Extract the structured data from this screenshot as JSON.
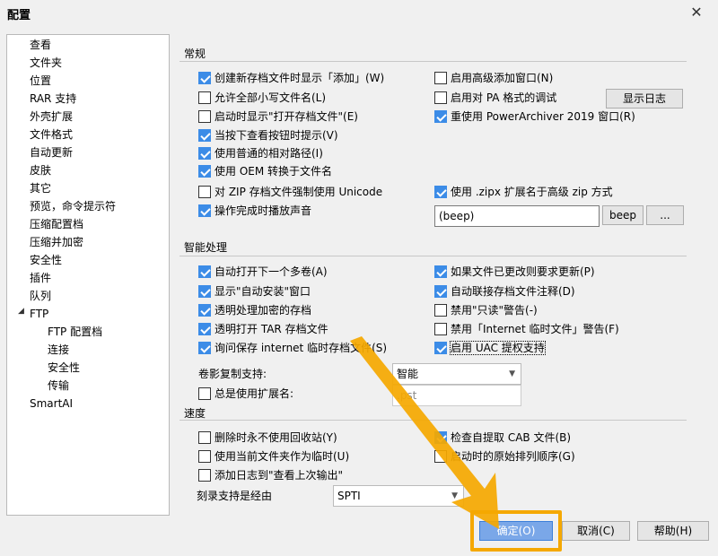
{
  "window": {
    "title": "配置",
    "close_glyph": "✕"
  },
  "tree": {
    "items": [
      "查看",
      "文件夹",
      "位置",
      "RAR 支持",
      "外壳扩展",
      "文件格式",
      "自动更新",
      "皮肤",
      "其它",
      "预览，命令提示符",
      "压缩配置档",
      "压缩并加密",
      "安全性",
      "插件",
      "队列",
      "FTP"
    ],
    "ftp_children": [
      "FTP 配置档",
      "连接",
      "安全性",
      "传输"
    ],
    "last": "SmartAI",
    "expand_glyph": "◢"
  },
  "general": {
    "title": "常规",
    "left": [
      {
        "label": "创建新存档文件时显示「添加」(W)",
        "checked": true
      },
      {
        "label": "允许全部小写文件名(L)",
        "checked": false
      },
      {
        "label": "启动时显示\"打开存档文件\"(E)",
        "checked": false
      },
      {
        "label": "当按下查看按钮时提示(V)",
        "checked": true
      },
      {
        "label": "使用普通的相对路径(I)",
        "checked": true
      },
      {
        "label": "使用 OEM 转换于文件名",
        "checked": true
      },
      {
        "label": "对 ZIP 存档文件强制使用 Unicode",
        "checked": false
      },
      {
        "label": "操作完成时播放声音",
        "checked": true
      }
    ],
    "right": [
      {
        "label": "启用高级添加窗口(N)",
        "checked": false
      },
      {
        "label": "启用对 PA 格式的调试",
        "checked": false
      },
      {
        "label": "重使用 PowerArchiver 2019 窗口(R)",
        "checked": true
      },
      {
        "label": "使用 .zipx 扩展名于高级 zip 方式",
        "checked": true
      }
    ],
    "show_log_button": "显示日志",
    "sound_value": "(beep)",
    "beep_button": "beep",
    "browse_button": "..."
  },
  "smart": {
    "title": "智能处理",
    "left": [
      {
        "label": "自动打开下一个多卷(A)",
        "checked": true
      },
      {
        "label": "显示\"自动安装\"窗口",
        "checked": true
      },
      {
        "label": "透明处理加密的存档",
        "checked": true
      },
      {
        "label": "透明打开 TAR 存档文件",
        "checked": true
      },
      {
        "label": "询问保存 internet 临时存档文件(S)",
        "checked": true
      }
    ],
    "right": [
      {
        "label": "如果文件已更改则要求更新(P)",
        "checked": true
      },
      {
        "label": "自动联接存档文件注释(D)",
        "checked": true
      },
      {
        "label": "禁用\"只读\"警告(-)",
        "checked": false
      },
      {
        "label": "禁用「Internet 临时文件」警告(F)",
        "checked": false
      },
      {
        "label": "启用 UAC 提权支持",
        "checked": true
      }
    ],
    "shadow_label": "卷影复制支持:",
    "shadow_value": "智能",
    "always_ext_label": "总是使用扩展名:",
    "always_ext_checked": false,
    "ext_value": ".pst"
  },
  "speed": {
    "title": "速度",
    "left": [
      {
        "label": "删除时永不使用回收站(Y)",
        "checked": false
      },
      {
        "label": "使用当前文件夹作为临时(U)",
        "checked": false
      },
      {
        "label": "添加日志到\"查看上次输出\"",
        "checked": false
      }
    ],
    "right": [
      {
        "label": "检查自提取 CAB 文件(B)",
        "checked": true
      },
      {
        "label": "启动时的原始排列顺序(G)",
        "checked": false
      }
    ],
    "burn_label": "刻录支持是经由",
    "burn_value": "SPTI"
  },
  "footer": {
    "ok": "确定(O)",
    "cancel": "取消(C)",
    "help": "帮助(H)"
  },
  "colors": {
    "accent": "#3c8ce7",
    "highlight": "#f5a800"
  }
}
